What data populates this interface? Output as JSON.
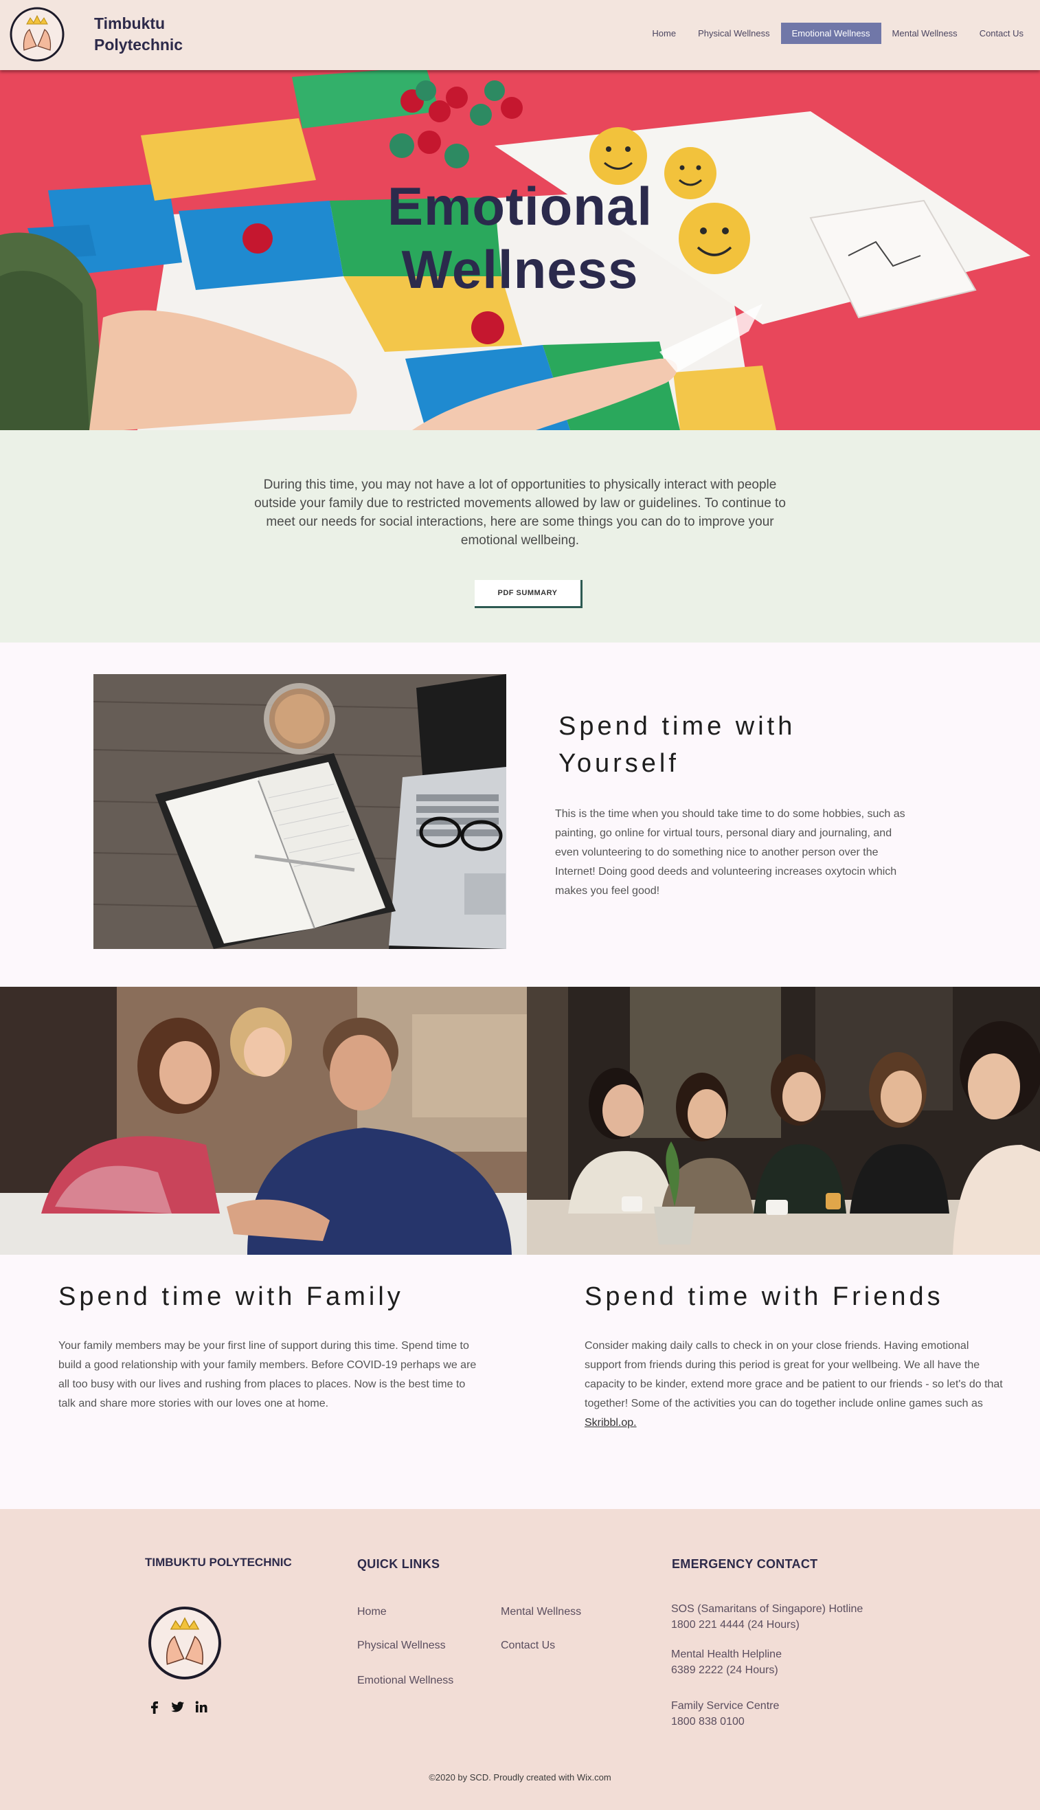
{
  "header": {
    "brand_line1": "Timbuktu",
    "brand_line2": "Polytechnic",
    "nav": [
      {
        "label": "Home"
      },
      {
        "label": "Physical Wellness"
      },
      {
        "label": "Emotional Wellness",
        "active": true
      },
      {
        "label": "Mental Wellness"
      },
      {
        "label": "Contact Us"
      }
    ]
  },
  "hero": {
    "title_line1": "Emotional",
    "title_line2": "Wellness"
  },
  "intro": {
    "text": "During this time, you may not have a lot of opportunities to physically interact with people outside your family due to restricted movements allowed by law or guidelines. To continue to meet our needs for social interactions, here are some things you can do to improve your emotional wellbeing.",
    "button_label": "PDF SUMMARY"
  },
  "yourself": {
    "heading_line1": "Spend time with",
    "heading_line2": "Yourself",
    "body": "This is the time when you should take time to do some hobbies, such as painting, go online for virtual tours, personal diary and journaling, and even volunteering to do something nice to another person over the Internet! Doing good deeds and volunteering increases oxytocin which makes you feel good!"
  },
  "family": {
    "heading": "Spend time with Family",
    "body": "Your family members may be your first line of support during this time. Spend time to build a good relationship with your family members. Before COVID-19 perhaps we are all too busy with our lives and rushing from places to places. Now is the best time to talk and share more stories with our loves one at home."
  },
  "friends": {
    "heading": "Spend time with Friends",
    "body": "Consider making daily calls to check in on your close friends. Having emotional support from friends during this period is great for your wellbeing. We all have the capacity to be kinder, extend more grace and be patient to our friends - so let's do that together! Some of the activities you can do together include online games such as ",
    "link_label": "Skribbl.op."
  },
  "footer": {
    "brand": "TIMBUKTU POLYTECHNIC",
    "quick_links_heading": "QUICK LINKS",
    "quick_links": [
      "Home",
      "Physical Wellness",
      "Emotional Wellness",
      "Mental Wellness",
      "Contact Us"
    ],
    "emergency_heading": "EMERGENCY CONTACT",
    "contacts": [
      {
        "name": "SOS (Samaritans of Singapore) Hotline",
        "number": "1800 221 4444 (24 Hours)"
      },
      {
        "name": "Mental Health Helpline",
        "number": "6389 2222 (24 Hours)"
      },
      {
        "name": "Family Service Centre",
        "number": "1800 838 0100"
      }
    ],
    "socials": [
      "facebook-icon",
      "twitter-icon",
      "linkedin-icon"
    ],
    "copyright": "©2020 by SCD. Proudly created with Wix.com"
  },
  "colors": {
    "header_bg": "#f3e5de",
    "nav_active": "#7077a8",
    "title_navy": "#2b2a4c",
    "intro_bg": "#ebf1e7",
    "page_bg": "#fdf8fc",
    "footer_bg": "#f2ddd6",
    "button_accent": "#2d5a52"
  }
}
